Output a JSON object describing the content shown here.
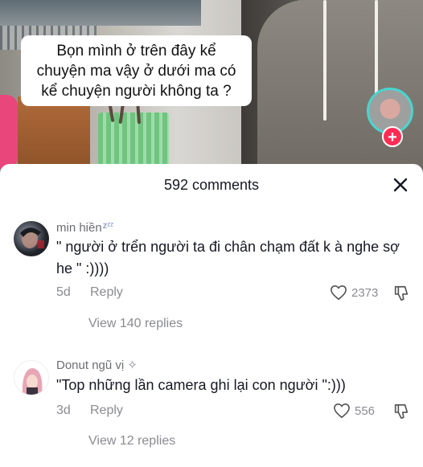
{
  "video": {
    "caption_lines": [
      "Bọn mình ở trên đây kể",
      "chuyện ma vậy ở dưới ma có",
      "kể chuyện người không ta ?"
    ],
    "follow_symbol": "+"
  },
  "sheet": {
    "title": "592 comments",
    "close_symbol": "×"
  },
  "comments": [
    {
      "username": "min hiền",
      "username_suffix": "zᶻᶻ",
      "text": "\" người ở trển người ta đi chân chạm đất k à nghe sợ he \" :))))",
      "age": "5d",
      "reply_label": "Reply",
      "likes": "2373",
      "view_replies": "View 140 replies"
    },
    {
      "username": "Donut ngũ vị",
      "username_suffix": "✧",
      "text": "\"Top những lần camera ghi lại con người \":)))",
      "age": "3d",
      "reply_label": "Reply",
      "likes": "556",
      "view_replies": "View 12 replies"
    }
  ],
  "colors": {
    "accent": "#fe2c55",
    "avatar_ring": "#49d5cf",
    "text_primary": "#161823",
    "text_secondary": "#8a8b91"
  }
}
